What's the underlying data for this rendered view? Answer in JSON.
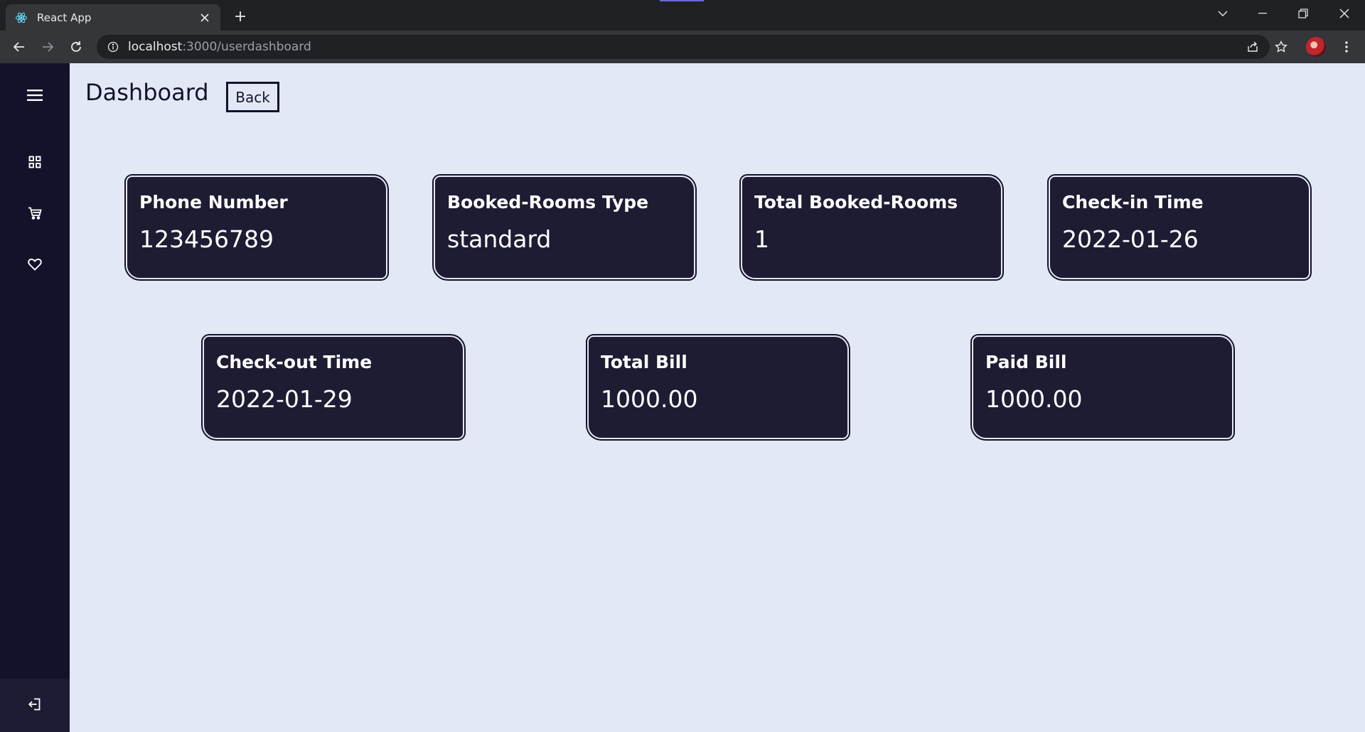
{
  "browser": {
    "tab_title": "React App",
    "url_host": "localhost",
    "url_rest": ":3000/userdashboard"
  },
  "header": {
    "title": "Dashboard",
    "back_label": "Back"
  },
  "sidebar": {
    "items": [
      "menu-icon",
      "grid-icon",
      "cart-icon",
      "heart-icon"
    ],
    "footer_icon": "logout-icon"
  },
  "cards": [
    {
      "label": "Phone Number",
      "value": "123456789"
    },
    {
      "label": "Booked-Rooms Type",
      "value": "standard"
    },
    {
      "label": "Total Booked-Rooms",
      "value": "1"
    },
    {
      "label": "Check-in Time",
      "value": "2022-01-26"
    },
    {
      "label": "Check-out Time",
      "value": "2022-01-29"
    },
    {
      "label": "Total Bill",
      "value": "1000.00"
    },
    {
      "label": "Paid Bill",
      "value": "1000.00"
    }
  ],
  "colors": {
    "sidebar": "#12132a",
    "card": "#1d1c33",
    "page_bg": "#e3e8f6"
  }
}
